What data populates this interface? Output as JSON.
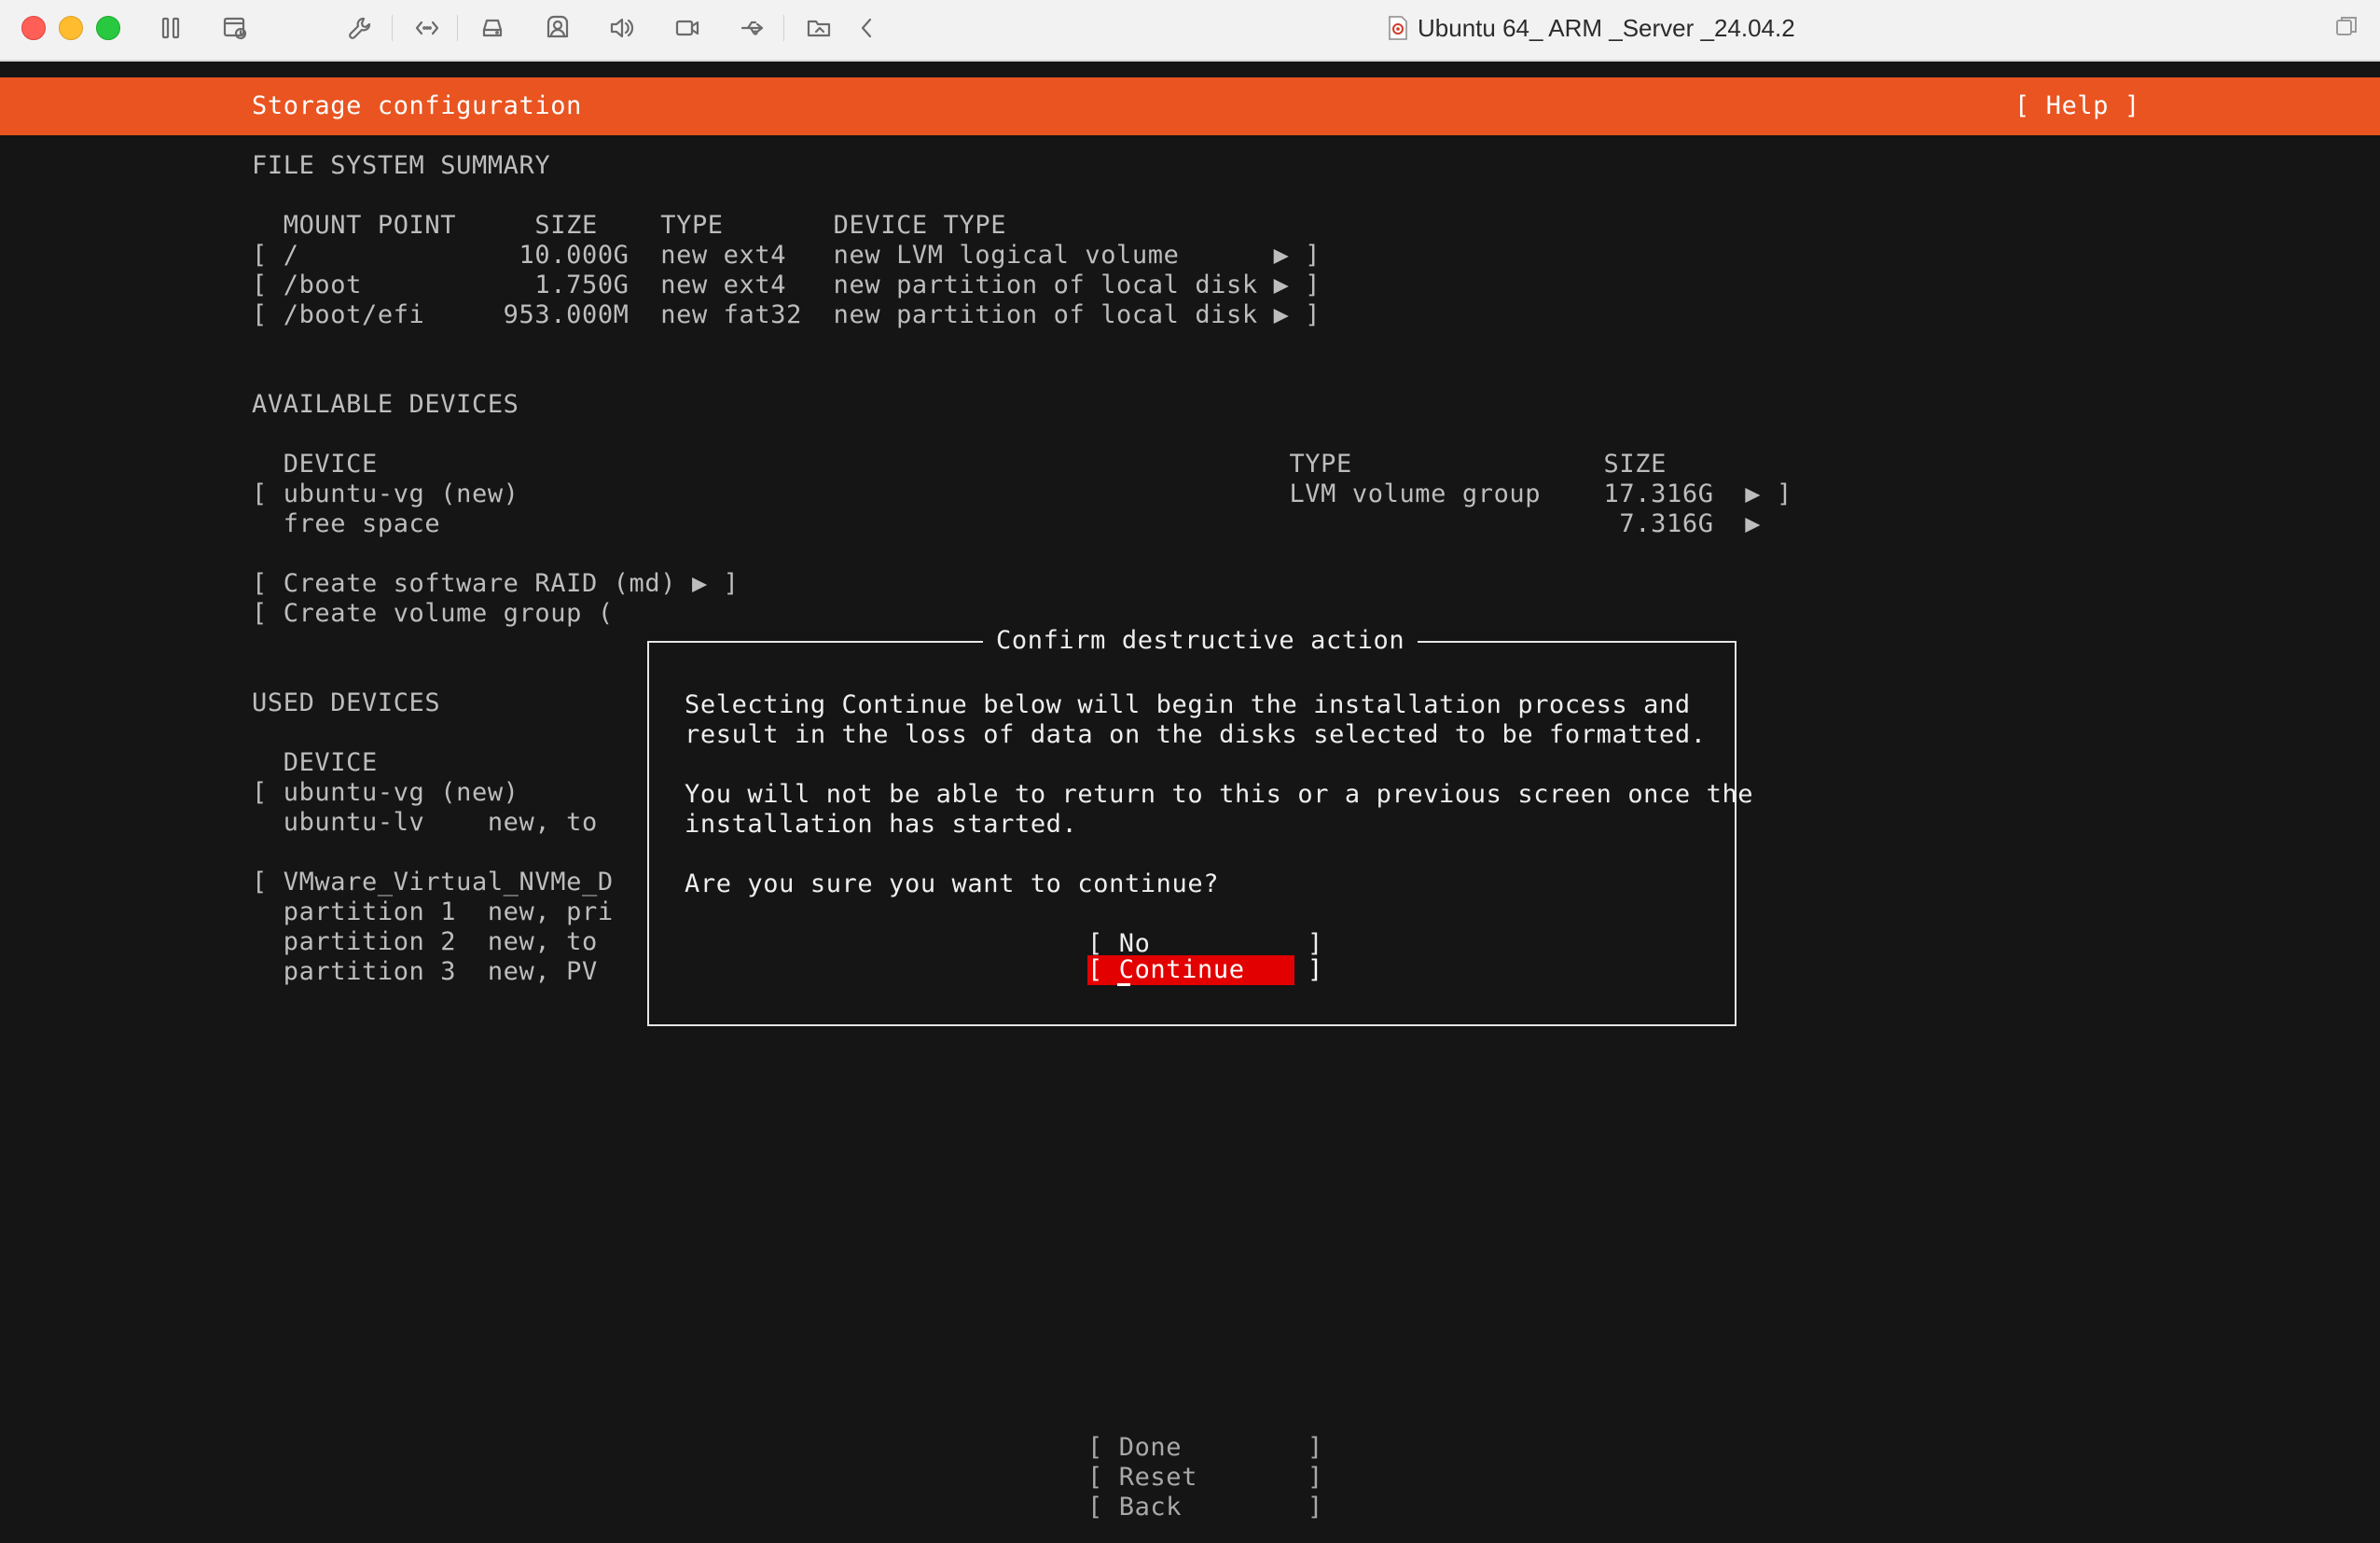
{
  "window": {
    "title": "Ubuntu 64_ ARM _Server _24.04.2",
    "toolbar_icons": [
      "pause-icon",
      "snapshot-icon",
      "settings-wrench-icon",
      "code-brackets-icon",
      "disk-drive-icon",
      "user-profile-icon",
      "volume-icon",
      "camera-icon",
      "usb-icon",
      "shared-folder-icon",
      "back-chevron-icon"
    ]
  },
  "header": {
    "title": "Storage configuration",
    "help": "[ Help ]",
    "accent_color": "#e95420"
  },
  "fs_summary": {
    "heading": "FILE SYSTEM SUMMARY",
    "columns": "  MOUNT POINT     SIZE    TYPE       DEVICE TYPE",
    "rows": [
      "[ /              10.000G  new ext4   new LVM logical volume      ▶ ]",
      "[ /boot           1.750G  new ext4   new partition of local disk ▶ ]",
      "[ /boot/efi     953.000M  new fat32  new partition of local disk ▶ ]"
    ]
  },
  "available_devices": {
    "heading": "AVAILABLE DEVICES",
    "columns": "  DEVICE                                                          TYPE                SIZE",
    "rows": [
      "[ ubuntu-vg (new)                                                 LVM volume group    17.316G  ▶ ]",
      "  free space                                                                           7.316G  ▶"
    ],
    "actions": [
      "[ Create software RAID (md) ▶ ]",
      "[ Create volume group ("
    ]
  },
  "used_devices": {
    "heading": "USED DEVICES",
    "columns": "  DEVICE",
    "rows": [
      "[ ubuntu-vg (new)",
      "  ubuntu-lv    new, to",
      "[ VMware_Virtual_NVMe_D",
      "  partition 1  new, pri",
      "  partition 2  new, to",
      "  partition 3  new, PV"
    ]
  },
  "dialog": {
    "title": "Confirm destructive action",
    "paragraph1": [
      "Selecting Continue below will begin the installation process and",
      "result in the loss of data on the disks selected to be formatted."
    ],
    "paragraph2": [
      "You will not be able to return to this or a previous screen once the",
      "installation has started."
    ],
    "question": "Are you sure you want to continue?",
    "no_button": "[ No          ]",
    "continue_button": "[ Continue    ]",
    "selected_color": "#e20000"
  },
  "footer": {
    "done": "[ Done        ]",
    "reset": "[ Reset       ]",
    "back": "[ Back        ]"
  }
}
